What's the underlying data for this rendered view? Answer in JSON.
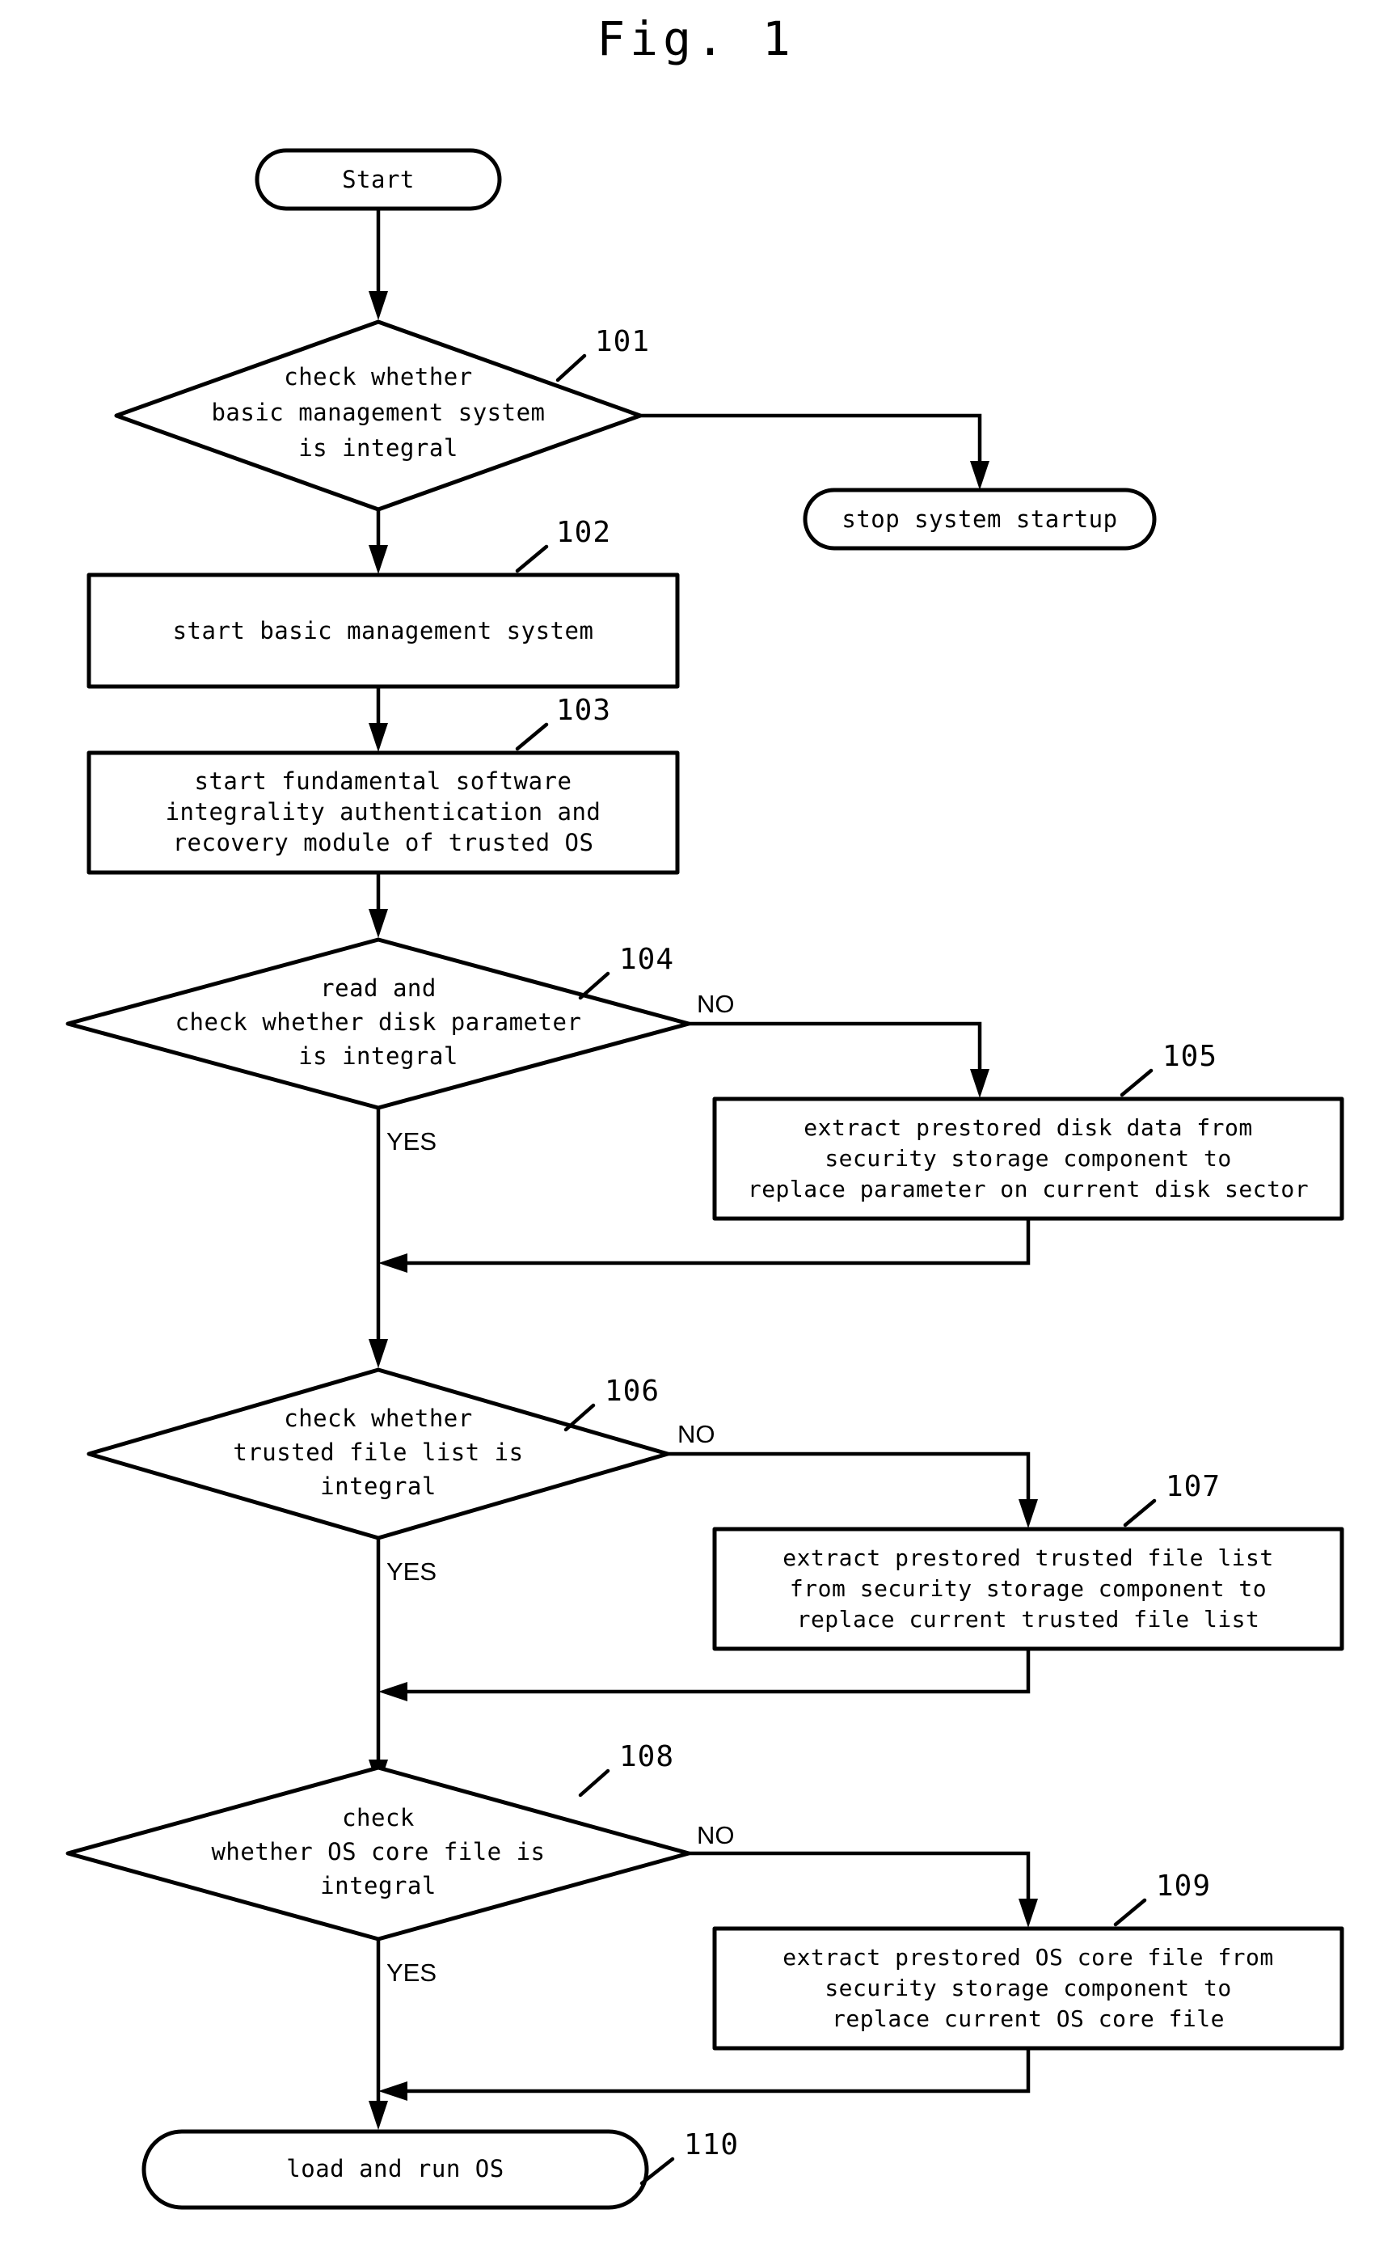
{
  "figure": {
    "title": "Fig. 1",
    "type": "flowchart",
    "caption_position": "top-center"
  },
  "nodes": [
    {
      "id": "start",
      "ref": "",
      "shape": "terminator",
      "lines": [
        "Start"
      ]
    },
    {
      "id": "n101",
      "ref": "101",
      "shape": "decision",
      "lines": [
        "check whether",
        "basic management system",
        "is integral"
      ]
    },
    {
      "id": "stop",
      "ref": "",
      "shape": "terminator",
      "lines": [
        "stop system startup"
      ]
    },
    {
      "id": "n102",
      "ref": "102",
      "shape": "process",
      "lines": [
        "start basic management system"
      ]
    },
    {
      "id": "n103",
      "ref": "103",
      "shape": "process",
      "lines": [
        "start fundamental software",
        "integrality authentication and",
        "recovery module of trusted OS"
      ]
    },
    {
      "id": "n104",
      "ref": "104",
      "shape": "decision",
      "lines": [
        "read and",
        "check whether disk parameter",
        "is integral"
      ]
    },
    {
      "id": "n105",
      "ref": "105",
      "shape": "process",
      "lines": [
        "extract prestored disk data from",
        "security storage component to",
        "replace parameter on current disk sector"
      ]
    },
    {
      "id": "n106",
      "ref": "106",
      "shape": "decision",
      "lines": [
        "check whether",
        "trusted file list is",
        "integral"
      ]
    },
    {
      "id": "n107",
      "ref": "107",
      "shape": "process",
      "lines": [
        "extract prestored trusted file list",
        "from security storage component to",
        "replace current trusted file list"
      ]
    },
    {
      "id": "n108",
      "ref": "108",
      "shape": "decision",
      "lines": [
        "check",
        "whether OS core file is",
        "integral"
      ]
    },
    {
      "id": "n109",
      "ref": "109",
      "shape": "process",
      "lines": [
        "extract prestored OS core file from",
        "security storage component to",
        "replace current OS core file"
      ]
    },
    {
      "id": "n110",
      "ref": "110",
      "shape": "terminator",
      "lines": [
        "load and run OS"
      ]
    }
  ],
  "branch_labels": {
    "no_104": "NO",
    "yes_104": "YES",
    "no_106": "NO",
    "yes_106": "YES",
    "no_108": "NO",
    "yes_108": "YES"
  },
  "text": {
    "start": "Start",
    "stop": "stop system startup",
    "n101_l1": "check whether",
    "n101_l2": "basic management system",
    "n101_l3": "is integral",
    "n102_l1": "start basic management system",
    "n103_l1": "start fundamental software",
    "n103_l2": "integrality authentication and",
    "n103_l3": "recovery module of trusted OS",
    "n104_l1": "read and",
    "n104_l2": "check whether disk parameter",
    "n104_l3": "is integral",
    "n105_l1": "extract prestored disk data from",
    "n105_l2": "security storage component to",
    "n105_l3": "replace parameter on current disk sector",
    "n106_l1": "check whether",
    "n106_l2": "trusted file list is",
    "n106_l3": "integral",
    "n107_l1": "extract prestored trusted file list",
    "n107_l2": "from security storage component to",
    "n107_l3": "replace current trusted file list",
    "n108_l1": "check",
    "n108_l2": "whether OS core file is",
    "n108_l3": "integral",
    "n109_l1": "extract prestored OS core file from",
    "n109_l2": "security storage component to",
    "n109_l3": "replace current OS core file",
    "n110_l1": "load and run OS"
  },
  "refs": {
    "r101": "101",
    "r102": "102",
    "r103": "103",
    "r104": "104",
    "r105": "105",
    "r106": "106",
    "r107": "107",
    "r108": "108",
    "r109": "109",
    "r110": "110"
  },
  "colors": {
    "stroke": "#000000",
    "fill": "#ffffff",
    "background": "#ffffff"
  }
}
